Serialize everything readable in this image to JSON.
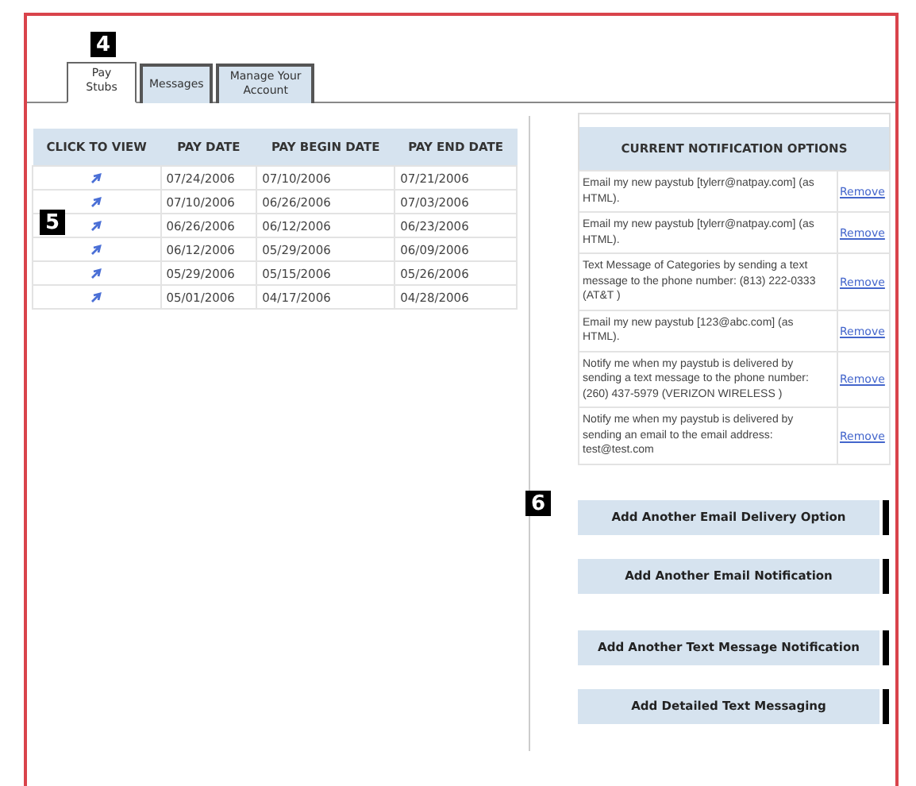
{
  "callouts": [
    "4",
    "5",
    "6"
  ],
  "tabs": [
    {
      "label": "Pay Stubs",
      "selected": true
    },
    {
      "label": "Messages",
      "selected": false
    },
    {
      "label": "Manage Your Account",
      "selected": false
    }
  ],
  "pay_table": {
    "columns": [
      "CLICK TO VIEW",
      "PAY DATE",
      "PAY BEGIN DATE",
      "PAY END DATE"
    ],
    "rows": [
      {
        "pay_date": "07/24/2006",
        "begin": "07/10/2006",
        "end": "07/21/2006"
      },
      {
        "pay_date": "07/10/2006",
        "begin": "06/26/2006",
        "end": "07/03/2006"
      },
      {
        "pay_date": "06/26/2006",
        "begin": "06/12/2006",
        "end": "06/23/2006"
      },
      {
        "pay_date": "06/12/2006",
        "begin": "05/29/2006",
        "end": "06/09/2006"
      },
      {
        "pay_date": "05/29/2006",
        "begin": "05/15/2006",
        "end": "05/26/2006"
      },
      {
        "pay_date": "05/01/2006",
        "begin": "04/17/2006",
        "end": "04/28/2006"
      }
    ]
  },
  "notifications": {
    "title": "CURRENT NOTIFICATION OPTIONS",
    "rows": [
      {
        "text": "Email my new paystub [tylerr@natpay.com] (as HTML).",
        "action": "Remove"
      },
      {
        "text": "Email my new paystub [tylerr@natpay.com] (as HTML).",
        "action": "Remove"
      },
      {
        "text": "Text Message of Categories by sending a text message to the phone number: (813) 222-0333 (AT&T )",
        "action": "Remove"
      },
      {
        "text": "Email my new paystub [123@abc.com] (as HTML).",
        "action": "Remove"
      },
      {
        "text": "Notify me when my paystub is delivered by sending a text message to the phone number: (260) 437-5979 (VERIZON WIRELESS )",
        "action": "Remove"
      },
      {
        "text": "Notify me when my paystub is delivered by sending an email to the email address: test@test.com",
        "action": "Remove"
      }
    ]
  },
  "buttons": [
    "Add Another Email Delivery Option",
    "Add Another Email Notification",
    "Add Another Text Message Notification",
    "Add Detailed Text Messaging"
  ]
}
